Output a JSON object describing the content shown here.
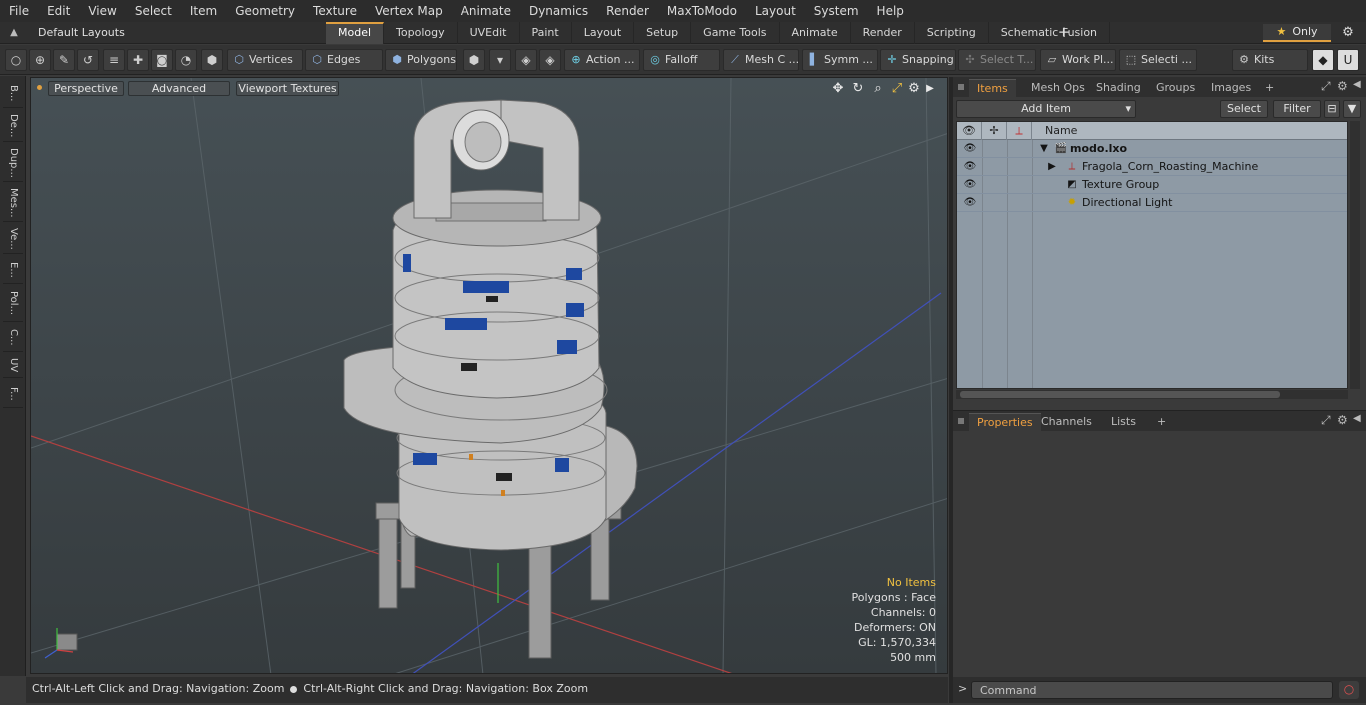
{
  "menu": [
    "File",
    "Edit",
    "View",
    "Select",
    "Item",
    "Geometry",
    "Texture",
    "Vertex Map",
    "Animate",
    "Dynamics",
    "Render",
    "MaxToModo",
    "Layout",
    "System",
    "Help"
  ],
  "layout_bar": {
    "layout_select": "Default Layouts",
    "tabs": [
      "Model",
      "Topology",
      "UVEdit",
      "Paint",
      "Layout",
      "Setup",
      "Game Tools",
      "Animate",
      "Render",
      "Scripting",
      "Schematic Fusion"
    ],
    "active_tab": "Model",
    "add_tab": "+",
    "only_label": "Only"
  },
  "toolbar": {
    "vertices": "Vertices",
    "edges": "Edges",
    "polygons": "Polygons",
    "action": "Action ...",
    "falloff": "Falloff",
    "mesh": "Mesh C ...",
    "symm": "Symm ...",
    "snapping": "Snapping",
    "select_t": "Select T...",
    "work_plane": "Work Pl...",
    "selecti": "Selecti ...",
    "kits": "Kits"
  },
  "left_tabs": [
    "B...",
    "De...",
    "Dup...",
    "Mes...",
    "Ve...",
    "E...",
    "Pol...",
    "C...",
    "UV",
    "F..."
  ],
  "viewport": {
    "perspective": "Perspective",
    "advanced": "Advanced",
    "textures": "Viewport Textures",
    "stats": {
      "selection": "No Items",
      "polygons": "Polygons : Face",
      "channels": "Channels: 0",
      "deformers": "Deformers: ON",
      "gl": "GL: 1,570,334",
      "scale": "500 mm"
    }
  },
  "statusbar": {
    "left": "Ctrl-Alt-Left Click and Drag: Navigation: Zoom",
    "right": "Ctrl-Alt-Right Click and Drag: Navigation: Box Zoom"
  },
  "items_panel": {
    "tabs": [
      "Items",
      "Mesh Ops",
      "Shading",
      "Groups",
      "Images"
    ],
    "active_tab": "Items",
    "add_item": "Add Item",
    "select_btn": "Select",
    "filter_btn": "Filter",
    "col_name": "Name",
    "rows": [
      {
        "label": "modo.lxo"
      },
      {
        "label": "Fragola_Corn_Roasting_Machine"
      },
      {
        "label": "Texture Group"
      },
      {
        "label": "Directional Light"
      }
    ]
  },
  "props_panel": {
    "tabs": [
      "Properties",
      "Channels",
      "Lists"
    ],
    "active_tab": "Properties"
  },
  "command": {
    "placeholder": "Command"
  }
}
